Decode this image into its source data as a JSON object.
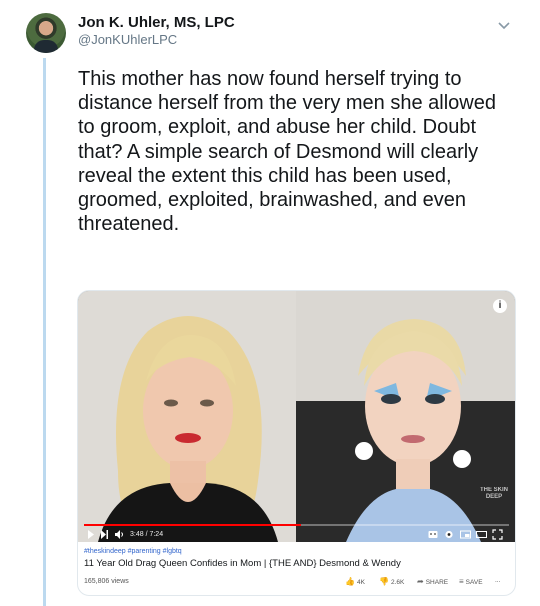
{
  "author": {
    "name": "Jon K. Uhler, MS, LPC",
    "handle": "@JonKUhlerLPC",
    "avatar_icon": "profile-photo"
  },
  "tweet": {
    "text": "This mother has now found herself trying to distance herself from the very men she allowed to groom, exploit, and abuse her child. Doubt that? A simple search of Desmond will clearly reveal the extent this child has been used, groomed, exploited, brainwashed, and even threatened."
  },
  "video": {
    "current_time": "3:48",
    "duration": "7:24",
    "time_display": "3:48 / 7:24",
    "progress_fraction": 0.51,
    "watermark": "THE SKIN DEEP",
    "hashtags": "#theskindeep #parenting #lgbtq",
    "title": "11 Year Old Drag Queen Confides in Mom | {THE AND} Desmond & Wendy",
    "views": "165,806 views",
    "likes": "4K",
    "dislikes": "2.6K",
    "share_label": "SHARE",
    "save_label": "SAVE",
    "more_label": "..."
  },
  "colors": {
    "rail": "#bcd9ef",
    "progress": "#ff0000",
    "handle": "#657786"
  }
}
